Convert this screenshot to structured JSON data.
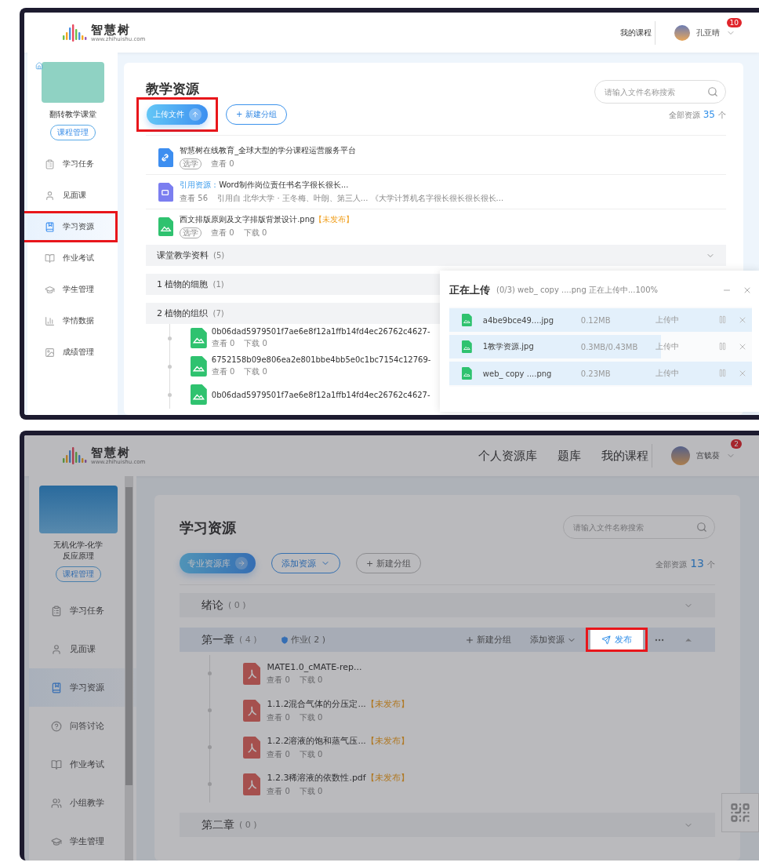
{
  "upload_screen": {
    "header": {
      "logo": "智慧树",
      "logo_url": "www.zhihuishu.com",
      "nav": [
        "我的课程"
      ],
      "user": "孔亚晴",
      "badge": "10"
    },
    "course": {
      "title": "翻转教学课堂",
      "manage": "课程管理"
    },
    "sidebar": [
      {
        "label": "学习任务",
        "selected": false,
        "highlighted": false
      },
      {
        "label": "见面课",
        "selected": false,
        "highlighted": false
      },
      {
        "label": "学习资源",
        "selected": true,
        "highlighted": true
      },
      {
        "label": "作业考试",
        "selected": false,
        "highlighted": false
      },
      {
        "label": "学生管理",
        "selected": false,
        "highlighted": false
      },
      {
        "label": "学情数据",
        "selected": false,
        "highlighted": false
      },
      {
        "label": "成绩管理",
        "selected": false,
        "highlighted": false
      }
    ],
    "title": "教学资源",
    "buttons": [
      {
        "label": "上传文件",
        "kind": "primary",
        "highlighted": true
      },
      {
        "label": "+ 新建分组",
        "kind": "outline",
        "highlighted": false
      }
    ],
    "search": {
      "placeholder": "请输入文件名称搜索"
    },
    "total": {
      "label": "全部资源",
      "count": "35",
      "unit": "个"
    },
    "files": [
      {
        "kind": "link",
        "name": "智慧树在线教育_全球大型的学分课程运营服务平台",
        "tag": "选学",
        "meta": [
          "查看 0"
        ]
      },
      {
        "kind": "video",
        "prefix": "引用资源：",
        "name": "Word制作岗位责任书名字很长很长...",
        "meta": [
          "查看 56",
          "引用自  北华大学 · 王冬梅、叶朗、第三人...  《大学计算机名字很长很长很长很长..."
        ]
      },
      {
        "kind": "image",
        "name": "西文排版原则及文字排版背景设计.png",
        "status": "【未发布】",
        "tag": "选学",
        "meta": [
          "查看 0",
          "下载 0"
        ]
      }
    ],
    "groups": [
      {
        "title": "课堂教学资料",
        "count": "(5)",
        "expanded": false
      },
      {
        "title": "1 植物的细胞",
        "count": "(1)"
      },
      {
        "title": "2 植物的组织",
        "count": "(7)",
        "files": [
          {
            "kind": "image",
            "name": "0b06dad5979501f7ae6e8f12a1ffb14fd4ec26762c4627-",
            "meta": [
              "查看 0",
              "下载 0"
            ]
          },
          {
            "kind": "image",
            "name": "6752158b09e806ea2e801bbe4bb5e0c1bc7154c12769-",
            "meta": [
              "查看 0",
              "下载 0"
            ]
          },
          {
            "kind": "image",
            "name": "0b06dad5979501f7ae6e8f12a1ffb14fd4ec26762c4627-"
          }
        ]
      }
    ],
    "upload": {
      "title": "正在上传",
      "summary": "(0/3)  web_ copy ....png 正在上传中...100%",
      "items": [
        {
          "name": "a4be9bce49....jpg",
          "size": "0.12MB",
          "status": "上传中",
          "level": 1
        },
        {
          "name": "1教学资源.jpg",
          "size": "0.3MB/0.43MB",
          "status": "上传中",
          "level": 0.7
        },
        {
          "name": "web_ copy ....png",
          "size": "0.23MB",
          "status": "上传中",
          "level": 1
        }
      ]
    }
  },
  "publish_screen": {
    "header": {
      "logo": "智慧树",
      "logo_url": "www.zhihuishu.com",
      "nav": [
        "个人资源库",
        "题库",
        "我的课程"
      ],
      "user": "宫毓葵",
      "badge": "2"
    },
    "course": {
      "title": "无机化学-化学反应原理",
      "manage": "课程管理"
    },
    "sidebar": [
      {
        "label": "学习任务",
        "selected": false
      },
      {
        "label": "见面课",
        "selected": false
      },
      {
        "label": "学习资源",
        "selected": true
      },
      {
        "label": "问答讨论",
        "selected": false
      },
      {
        "label": "作业考试",
        "selected": false
      },
      {
        "label": "小组教学",
        "selected": false
      },
      {
        "label": "学生管理",
        "selected": false
      }
    ],
    "title": "学习资源",
    "buttons": [
      {
        "label": "专业资源库",
        "kind": "primary"
      },
      {
        "label": "添加资源",
        "kind": "dropdown"
      },
      {
        "label": "+ 新建分组",
        "kind": "plain"
      }
    ],
    "search": {
      "placeholder": "请输入文件名称搜索"
    },
    "total": {
      "label": "全部资源",
      "count": "13",
      "unit": "个"
    },
    "groups": [
      {
        "title": "绪论",
        "count": "( 0 )",
        "expanded": false,
        "active": false
      },
      {
        "title": "第一章",
        "count": "( 4 )",
        "expanded": true,
        "active": true,
        "homework": "作业",
        "homework_count": "( 2 )",
        "actions": [
          "新建分组",
          "添加资源"
        ],
        "publish": {
          "label": "发布",
          "highlighted": true
        },
        "files": [
          {
            "kind": "pdf",
            "name": "MATE1.0_cMATE-rep...",
            "meta": [
              "查看 0",
              "下载 0"
            ]
          },
          {
            "kind": "pdf",
            "name": "1.1.2混合气体的分压定...",
            "status": "【未发布】",
            "meta": [
              "查看 0",
              "下载 0"
            ]
          },
          {
            "kind": "pdf",
            "name": "1.2.2溶液的饱和蒸气压...",
            "status": "【未发布】",
            "meta": [
              "查看 0",
              "下载 0"
            ]
          },
          {
            "kind": "pdf",
            "name": "1.2.3稀溶液的依数性.pdf",
            "status": "【未发布】",
            "meta": [
              "查看 0",
              "下载 0"
            ]
          }
        ]
      },
      {
        "title": "第二章",
        "count": "( 0 )",
        "expanded": false,
        "active": false
      }
    ]
  }
}
